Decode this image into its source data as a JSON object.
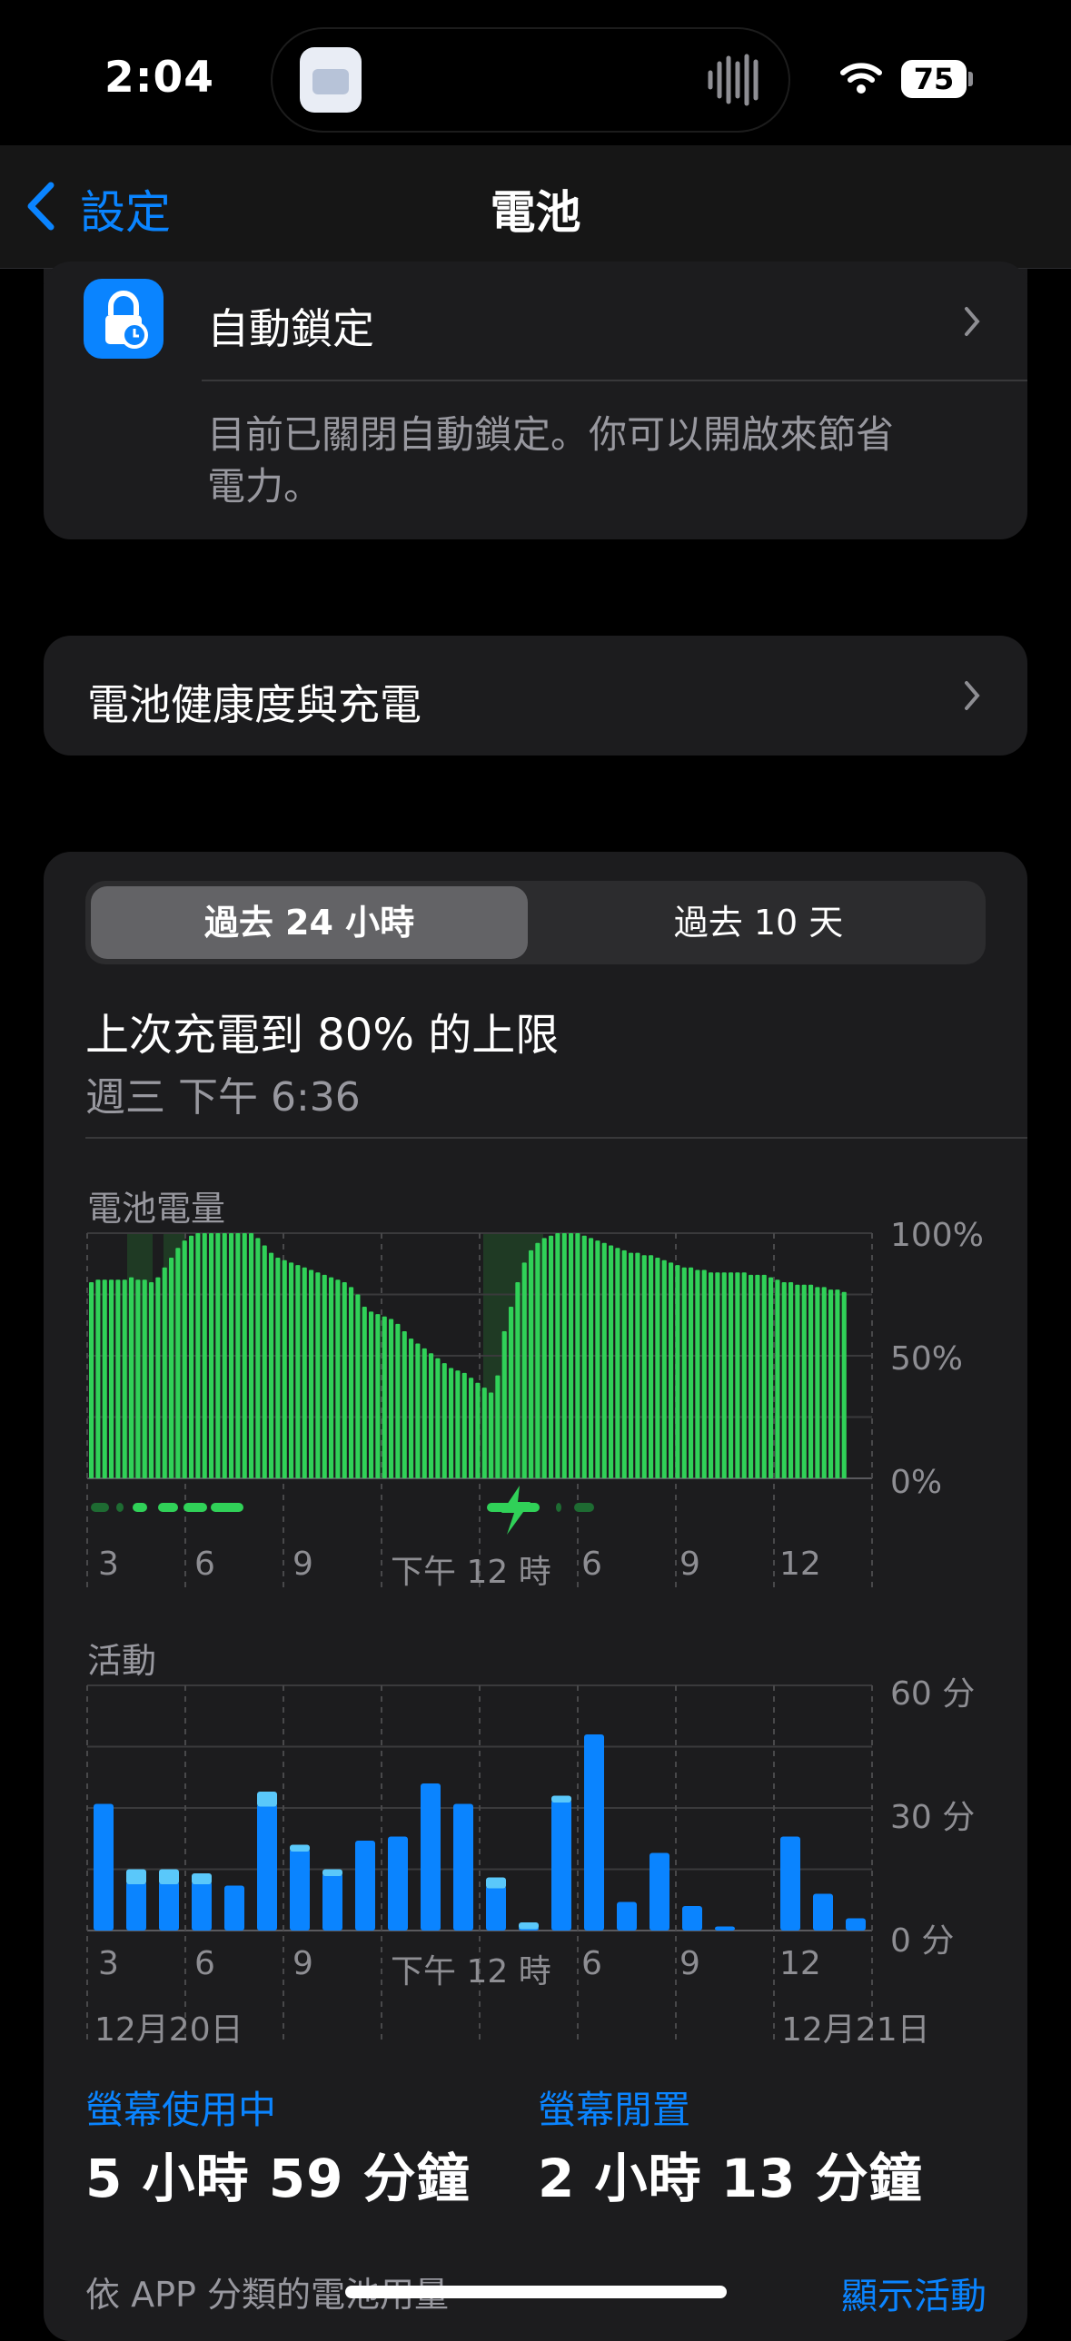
{
  "status": {
    "time": "2:04",
    "battery": "75"
  },
  "nav": {
    "back_label": "設定",
    "title": "電池"
  },
  "auto_lock": {
    "label": "自動鎖定",
    "description_line1": "目前已關閉自動鎖定。你可以開啟來節省",
    "description_line2": "電力。"
  },
  "health": {
    "label": "電池健康度與充電"
  },
  "segments": {
    "left": "過去 24 小時",
    "right": "過去 10 天"
  },
  "last_charge": {
    "title": "上次充電到 80% 的上限",
    "time": "週三 下午 6:36"
  },
  "battery_chart": {
    "title": "電池電量",
    "y_ticks": [
      "100%",
      "50%",
      "0%"
    ],
    "x_ticks": [
      "3",
      "6",
      "9",
      "下午 12 時",
      "6",
      "9",
      "12"
    ]
  },
  "activity_chart": {
    "title": "活動",
    "y_ticks": [
      "60 分",
      "30 分",
      "0 分"
    ],
    "x_ticks": [
      "3",
      "6",
      "9",
      "下午 12 時",
      "6",
      "9",
      "12"
    ],
    "date_left": "12月20日",
    "date_right": "12月21日"
  },
  "stats": {
    "screen_on_label": "螢幕使用中",
    "screen_on_value": "5 小時 59 分鐘",
    "screen_idle_label": "螢幕閒置",
    "screen_idle_value": "2 小時 13 分鐘"
  },
  "footer": {
    "by_app": "依 APP 分類的電池用量",
    "show_activity": "顯示活動"
  },
  "chart_data": [
    {
      "type": "bar",
      "title": "電池電量",
      "ylim": [
        0,
        100
      ],
      "x_ticks": [
        "3",
        "6",
        "9",
        "下午 12 時",
        "6",
        "9",
        "12"
      ],
      "values": [
        80,
        81,
        81,
        81,
        81,
        81,
        82,
        81,
        81,
        80,
        82,
        86,
        90,
        94,
        97,
        99,
        100,
        100,
        100,
        100,
        100,
        100,
        100,
        100,
        100,
        98,
        95,
        92,
        90,
        89,
        88,
        87,
        86,
        85,
        84,
        83,
        82,
        81,
        80,
        78,
        75,
        70,
        68,
        67,
        66,
        65,
        63,
        60,
        57,
        55,
        53,
        51,
        49,
        47,
        45,
        44,
        43,
        41,
        39,
        37,
        35,
        42,
        60,
        70,
        80,
        88,
        93,
        96,
        98,
        99,
        100,
        100,
        100,
        100,
        99,
        98,
        97,
        96,
        95,
        94,
        93,
        92,
        92,
        91,
        91,
        90,
        89,
        88,
        87,
        86,
        86,
        85,
        85,
        84,
        84,
        84,
        84,
        84,
        84,
        83,
        83,
        83,
        82,
        81,
        80,
        80,
        79,
        79,
        79,
        78,
        78,
        77,
        77,
        76
      ],
      "charging": true
    },
    {
      "type": "bar",
      "title": "活動",
      "ylim": [
        0,
        60
      ],
      "x_ticks": [
        "3",
        "6",
        "9",
        "下午 12 時",
        "6",
        "9",
        "12"
      ],
      "series": [
        {
          "name": "螢幕使用中",
          "values": [
            31,
            12,
            12,
            12,
            11,
            31,
            20,
            14,
            22,
            23,
            36,
            31,
            11,
            1,
            32,
            48,
            7,
            19,
            6,
            1,
            0,
            23,
            9,
            3
          ]
        },
        {
          "name": "螢幕閒置",
          "values": [
            0,
            3,
            3,
            2,
            0,
            3,
            1,
            1,
            0,
            0,
            0,
            0,
            2,
            1,
            1,
            0,
            0,
            0,
            0,
            0,
            0,
            0,
            0,
            0
          ]
        }
      ]
    }
  ]
}
